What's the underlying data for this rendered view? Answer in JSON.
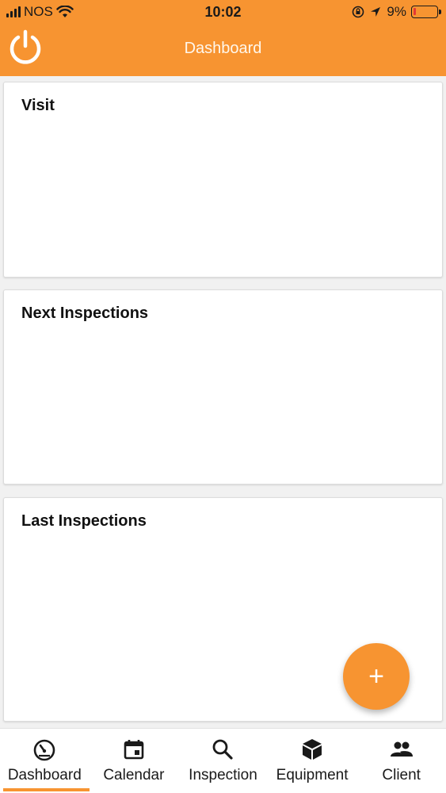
{
  "status_bar": {
    "carrier": "NOS",
    "time": "10:02",
    "battery": "9%",
    "battery_level": 0.09
  },
  "header": {
    "title": "Dashboard",
    "power_icon": "power-icon",
    "background_color": "#f79431"
  },
  "cards": {
    "visit": {
      "title": "Visit"
    },
    "next": {
      "title": "Next Inspections"
    },
    "last": {
      "title": "Last Inspections"
    }
  },
  "fab": {
    "label": "+",
    "icon": "plus-icon"
  },
  "nav": {
    "items": [
      {
        "label": "Dashboard",
        "icon": "speedometer-icon",
        "active": true
      },
      {
        "label": "Calendar",
        "icon": "calendar-icon",
        "active": false
      },
      {
        "label": "Inspection",
        "icon": "search-icon",
        "active": false
      },
      {
        "label": "Equipment",
        "icon": "cube-icon",
        "active": false
      },
      {
        "label": "Client",
        "icon": "people-icon",
        "active": false
      }
    ],
    "accent_color": "#f79431"
  }
}
